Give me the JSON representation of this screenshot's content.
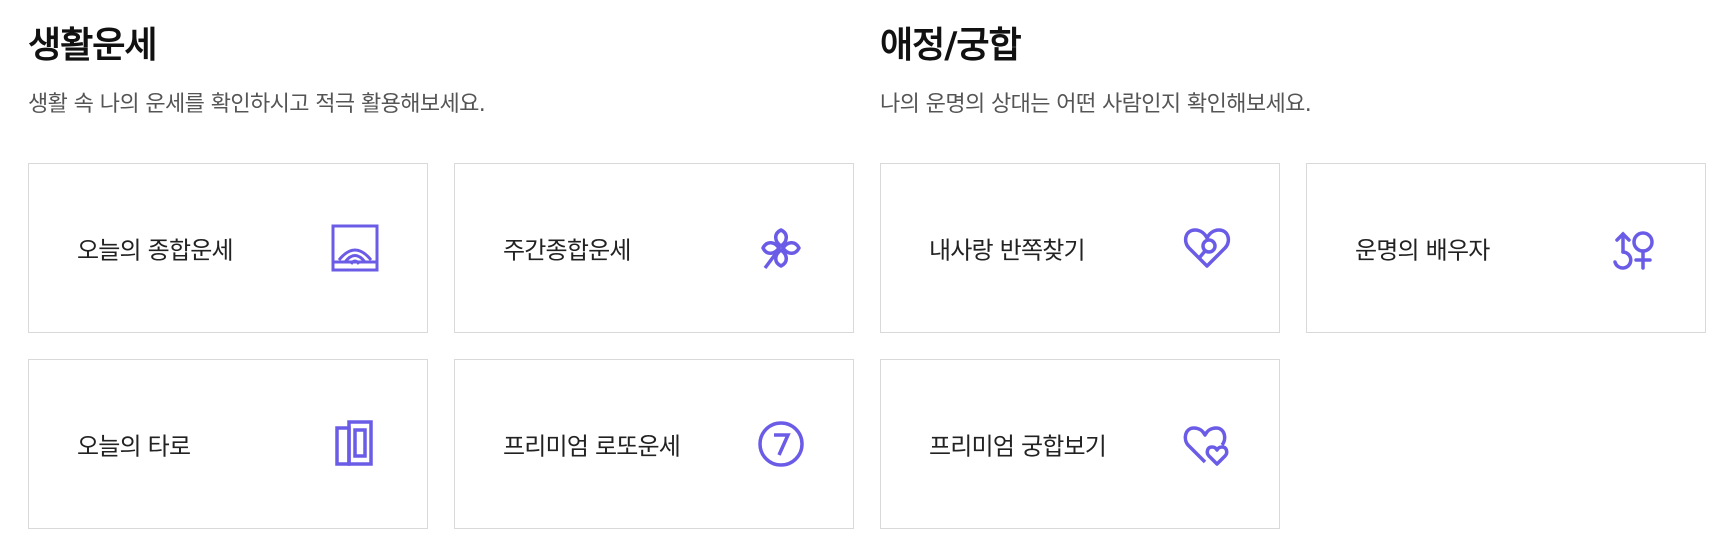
{
  "accent_color": "#6b5ce7",
  "sections": [
    {
      "title": "생활운세",
      "description": "생활 속 나의 운세를 확인하시고 적극 활용해보세요.",
      "cards": [
        {
          "label": "오늘의 종합운세",
          "icon": "sunrise-frame-icon"
        },
        {
          "label": "주간종합운세",
          "icon": "clover-icon"
        },
        {
          "label": "오늘의 타로",
          "icon": "tarot-cards-icon"
        },
        {
          "label": "프리미엄 로또운세",
          "icon": "lotto-seven-icon"
        }
      ]
    },
    {
      "title": "애정/궁합",
      "description": "나의 운명의 상대는 어떤 사람인지 확인해보세요.",
      "cards": [
        {
          "label": "내사랑 반쪽찾기",
          "icon": "heart-search-icon"
        },
        {
          "label": "운명의 배우자",
          "icon": "gender-symbols-icon"
        },
        {
          "label": "프리미엄 궁합보기",
          "icon": "double-heart-icon"
        }
      ]
    }
  ]
}
